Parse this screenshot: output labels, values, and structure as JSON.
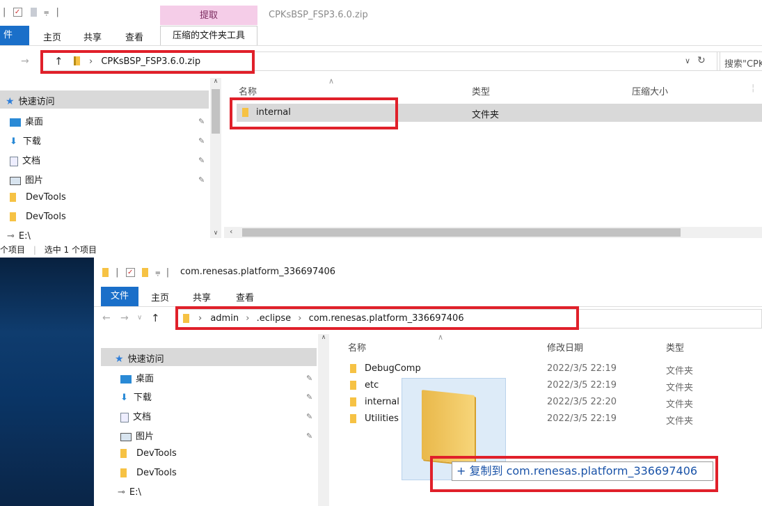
{
  "top": {
    "title_tab_extract": "提取",
    "window_title": "CPKsBSP_FSP3.6.0.zip",
    "ribbon_tabs": [
      "件",
      "主页",
      "共享",
      "查看",
      "压缩的文件夹工具"
    ],
    "address": "CPKsBSP_FSP3.6.0.zip",
    "search_placeholder": "搜索\"CPK",
    "nav": {
      "quick_access": "快速访问",
      "items": [
        "桌面",
        "下载",
        "文档",
        "图片",
        "DevTools",
        "DevTools",
        "E:\\"
      ]
    },
    "columns": [
      "名称",
      "类型",
      "压缩大小"
    ],
    "rows": [
      {
        "name": "internal",
        "type": "文件夹"
      }
    ],
    "status_items": "个项目",
    "status_selected": "选中 1 个项目"
  },
  "bottom": {
    "window_title": "com.renesas.platform_336697406",
    "ribbon_tabs": [
      "文件",
      "主页",
      "共享",
      "查看"
    ],
    "breadcrumb": [
      "admin",
      ".eclipse",
      "com.renesas.platform_336697406"
    ],
    "nav": {
      "quick_access": "快速访问",
      "items": [
        "桌面",
        "下载",
        "文档",
        "图片",
        "DevTools",
        "DevTools",
        "E:\\"
      ]
    },
    "columns": [
      "名称",
      "修改日期",
      "类型"
    ],
    "rows": [
      {
        "name": "DebugComp",
        "date": "2022/3/5 22:19",
        "type": "文件夹"
      },
      {
        "name": "etc",
        "date": "2022/3/5 22:19",
        "type": "文件夹"
      },
      {
        "name": "internal",
        "date": "2022/3/5 22:20",
        "type": "文件夹"
      },
      {
        "name": "Utilities",
        "date": "2022/3/5 22:19",
        "type": "文件夹"
      }
    ],
    "drag_tooltip": "+ 复制到 com.renesas.platform_336697406"
  },
  "colors": {
    "accent": "#1a6fc9",
    "highlight": "#e0202a",
    "selection": "#d9d9d9",
    "tab_pink": "#f5cde8"
  }
}
